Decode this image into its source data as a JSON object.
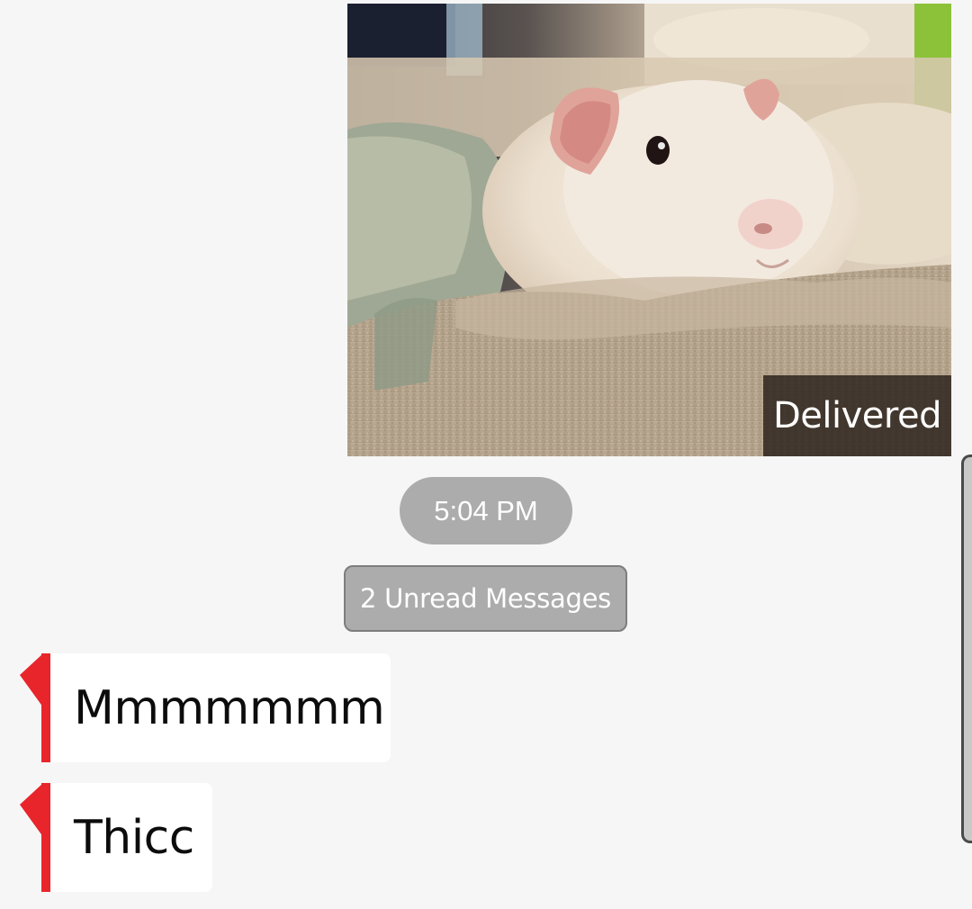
{
  "conversation": {
    "sent_photo": {
      "description_icon": "guinea-pig-photo",
      "status": "Delivered"
    },
    "timestamp": "5:04 PM",
    "unread_divider": "2 Unread Messages",
    "incoming_messages": [
      {
        "text": "Mmmmmmm"
      },
      {
        "text": "Thicc"
      }
    ]
  },
  "colors": {
    "background": "#f6f6f6",
    "pill": "#acacac",
    "incoming_accent": "#e8252b",
    "bubble": "#ffffff"
  }
}
